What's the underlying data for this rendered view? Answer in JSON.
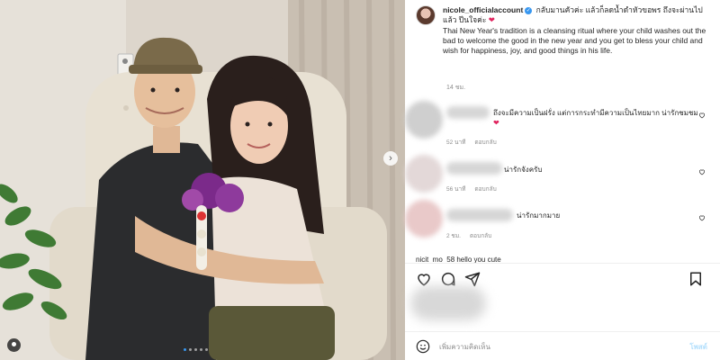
{
  "post": {
    "username": "nicole_officialaccount",
    "verified": true,
    "caption_thai": "กลับมานคัวค่ะ แล้วก็ลดน้ำดำหัวขอพร ถึงจะผ่านไปแล้ว ปีนใจค่ะ",
    "caption_en": "Thai New Year's tradition is a cleansing ritual where your child washes out the bad to welcome the good in the new year and you get to bless your child and wish for happiness, joy, and good things in his life.",
    "time": "14 ชม."
  },
  "comments": [
    {
      "text": "ถึงจะมีความเป็นฝรั่ง แต่การกระทำมีความเป็นไทยมาก น่ารักชมชม",
      "time": "52 นาที",
      "reply": "ตอบกลับ"
    },
    {
      "text": "น่ารักจังครับ",
      "time": "56 นาที",
      "reply": "ตอบกลับ"
    },
    {
      "text": "น่ารักมากมาย",
      "time": "2 ชม.",
      "reply": "ตอบกลับ"
    }
  ],
  "partial_comment": "nicit_mo_58 hello you cute",
  "add_comment": {
    "placeholder": "เพิ่มความคิดเห็น",
    "post_label": "โพสต์"
  },
  "icons": [
    "heart-icon",
    "comment-icon",
    "share-icon",
    "bookmark-icon",
    "emoji-icon",
    "chevron-right-icon",
    "user-tag-icon"
  ],
  "colors": {
    "link": "#3897f0",
    "heart": "#e0245e",
    "post_disabled": "#b2dffc"
  },
  "carousel": {
    "total": 5,
    "active": 1
  }
}
